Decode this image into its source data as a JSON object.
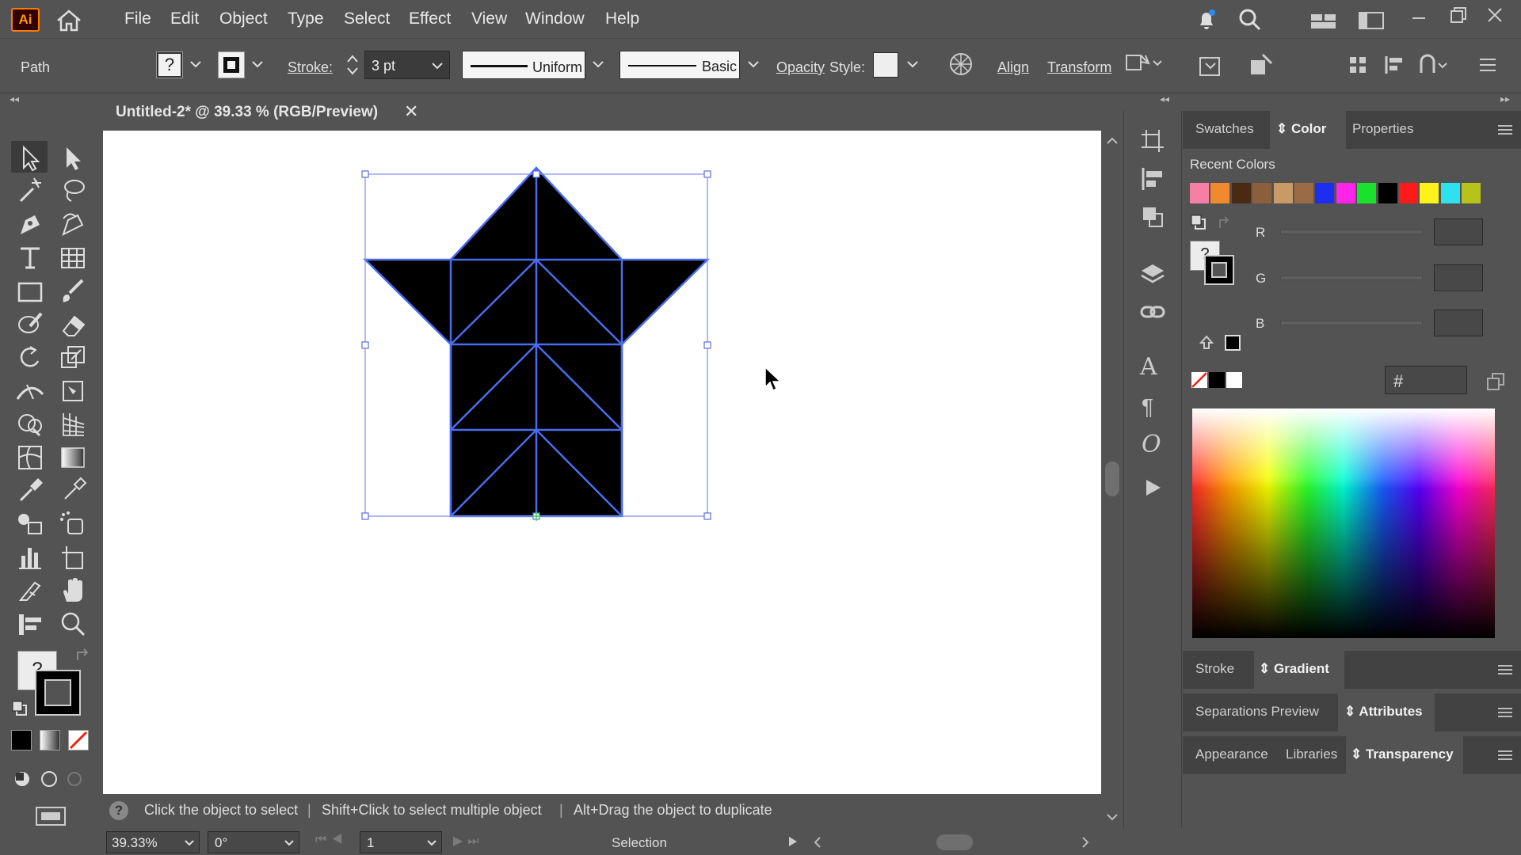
{
  "app": {
    "logo_text": "Ai"
  },
  "menu": [
    "File",
    "Edit",
    "Object",
    "Type",
    "Select",
    "Effect",
    "View",
    "Window",
    "Help"
  ],
  "control": {
    "selection_label": "Path",
    "fill_unknown": "?",
    "stroke_label": "Stroke:",
    "stroke_value": "3 pt",
    "profile_label": "Uniform",
    "brush_label": "Basic",
    "opacity_label": "Opacity",
    "style_label": "Style:",
    "align_label": "Align",
    "transform_label": "Transform"
  },
  "document": {
    "tab_title": "Untitled-2* @ 39.33 % (RGB/Preview)"
  },
  "status": {
    "hint_1": "Click the object to select",
    "hint_2": "Shift+Click to select multiple object",
    "hint_3": "Alt+Drag the object to duplicate"
  },
  "bottom": {
    "zoom": "39.33%",
    "rotation": "0°",
    "artboard": "1",
    "tool_name": "Selection"
  },
  "color_panel": {
    "tabs": [
      "Swatches",
      "Color",
      "Properties"
    ],
    "active_tab": "Color",
    "recent_label": "Recent Colors",
    "recent_colors": [
      "#f57fa5",
      "#f08a2c",
      "#4b2a13",
      "#8b5e3c",
      "#c89a66",
      "#9a6b45",
      "#1e2df0",
      "#ff25e8",
      "#18e22d",
      "#000000",
      "#ff1a1a",
      "#fff21b",
      "#2fe1ef",
      "#b7c21b"
    ],
    "channels": [
      "R",
      "G",
      "B"
    ],
    "hex_label": "#",
    "fill_unknown": "?"
  },
  "panels": {
    "row1": [
      "Stroke",
      "Gradient"
    ],
    "row1_active": "Gradient",
    "row2": [
      "Separations Preview",
      "Attributes"
    ],
    "row2_active": "Attributes",
    "row3": [
      "Appearance",
      "Libraries",
      "Transparency"
    ],
    "row3_active": "Transparency"
  },
  "toolbar": {
    "fill_unknown": "?"
  }
}
